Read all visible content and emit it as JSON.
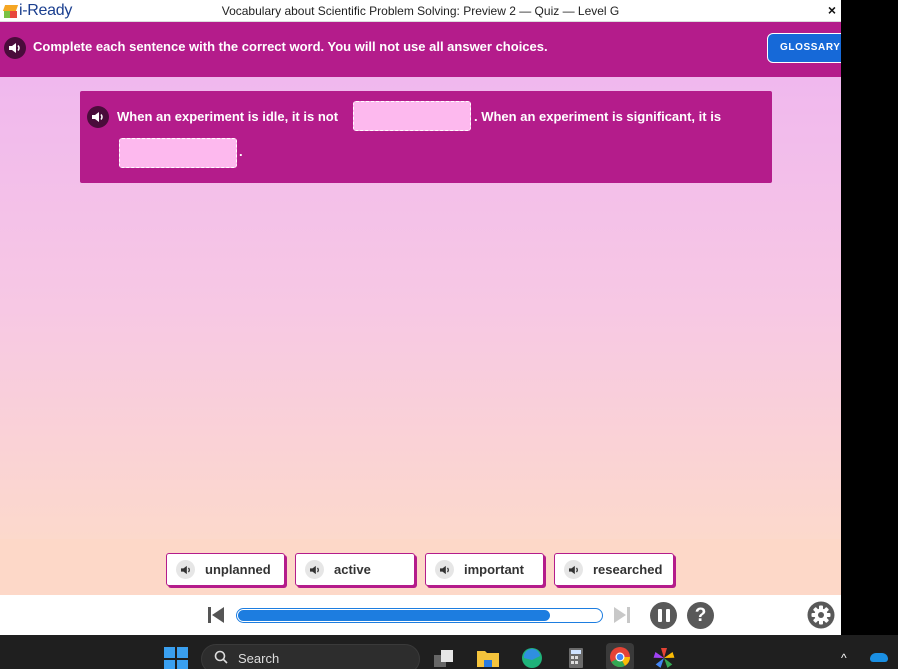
{
  "app": {
    "logo_text": "i-Ready",
    "quiz_title": "Vocabulary about Scientific Problem Solving: Preview 2 — Quiz — Level G",
    "close_label": "×"
  },
  "instruction": {
    "text": "Complete each sentence with the correct word. You will not use all answer choices.",
    "glossary_label": "GLOSSARY"
  },
  "question": {
    "part1": "When an experiment is idle, it is not",
    "part2": ". When an experiment is significant, it is",
    "part3": "."
  },
  "choices": [
    {
      "label": "unplanned"
    },
    {
      "label": "active"
    },
    {
      "label": "important"
    },
    {
      "label": "researched"
    }
  ],
  "player": {
    "progress_fraction": 0.86,
    "help_label": "?"
  },
  "taskbar": {
    "search_placeholder": "Search",
    "chevron": "^"
  },
  "colors": {
    "accent_magenta": "#b41c8b",
    "glossary_blue": "#1669d8",
    "progress_blue": "#1d7de0"
  },
  "icons": {
    "speaker": "speaker-icon",
    "rewind": "skip-to-start-icon",
    "skip_end": "skip-to-end-icon",
    "pause": "pause-icon",
    "help": "help-icon",
    "settings": "gear-icon"
  }
}
